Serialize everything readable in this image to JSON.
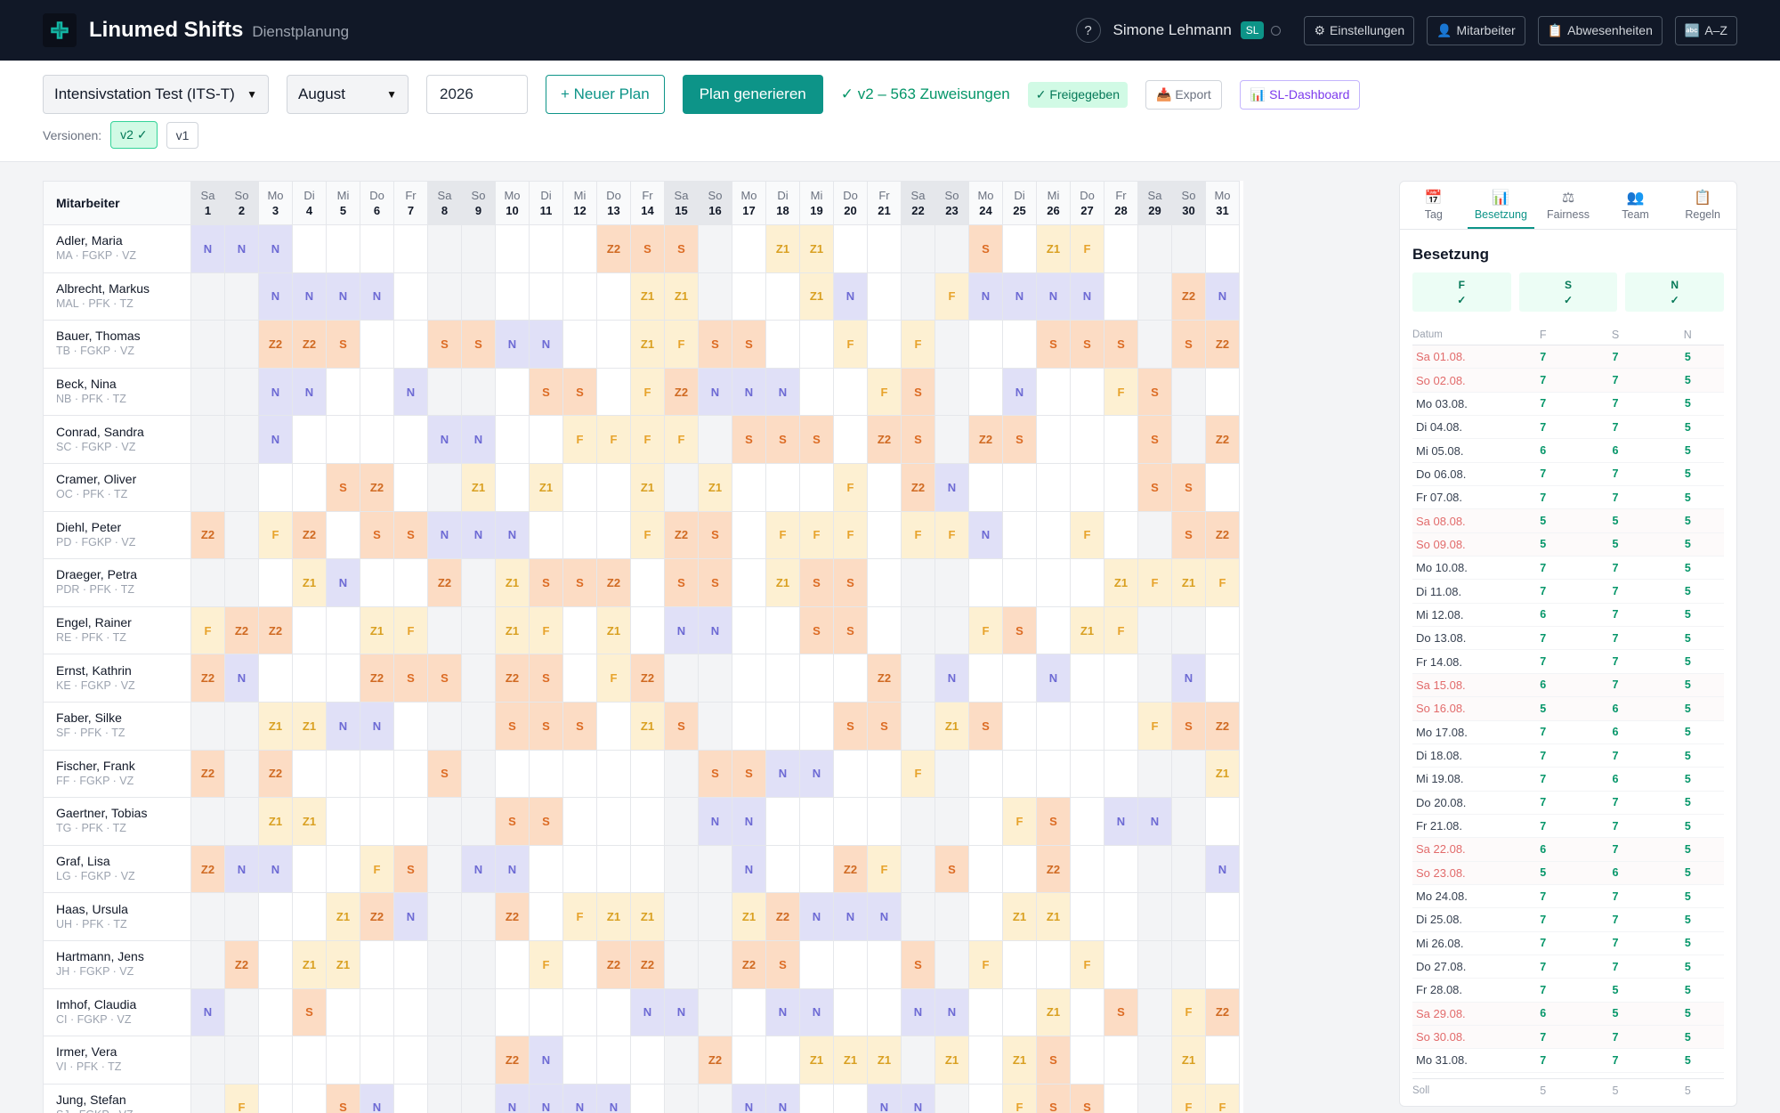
{
  "app": {
    "title": "Linumed Shifts",
    "subtitle": "Dienstplanung"
  },
  "topnav": {
    "help": "?",
    "user_name": "Simone Lehmann",
    "user_badge": "SL",
    "buttons": [
      {
        "icon": "gear-icon",
        "glyph": "⚙",
        "label": "Einstellungen"
      },
      {
        "icon": "user-icon",
        "glyph": "👤",
        "label": "Mitarbeiter"
      },
      {
        "icon": "clipboard-icon",
        "glyph": "📋",
        "label": "Abwesenheiten"
      },
      {
        "icon": "sort-az-icon",
        "glyph": "🔤",
        "label": "A–Z"
      }
    ]
  },
  "controls": {
    "station": "Intensivstation Test (ITS-T)",
    "month": "August",
    "year": "2026",
    "new_plan": "+ Neuer Plan",
    "generate": "Plan generieren",
    "status": "✓ v2 – 563 Zuweisungen",
    "released": "✓ Freigegeben",
    "export": "📥 Export",
    "sl_dashboard": "📊 SL-Dashboard",
    "versions_label": "Versionen:",
    "versions": [
      "v2 ✓",
      "v1"
    ]
  },
  "grid": {
    "employee_header": "Mitarbeiter",
    "days": [
      {
        "n": "Sa",
        "d": "1",
        "we": true
      },
      {
        "n": "So",
        "d": "2",
        "we": true
      },
      {
        "n": "Mo",
        "d": "3"
      },
      {
        "n": "Di",
        "d": "4"
      },
      {
        "n": "Mi",
        "d": "5"
      },
      {
        "n": "Do",
        "d": "6"
      },
      {
        "n": "Fr",
        "d": "7"
      },
      {
        "n": "Sa",
        "d": "8",
        "we": true
      },
      {
        "n": "So",
        "d": "9",
        "we": true
      },
      {
        "n": "Mo",
        "d": "10"
      },
      {
        "n": "Di",
        "d": "11"
      },
      {
        "n": "Mi",
        "d": "12"
      },
      {
        "n": "Do",
        "d": "13"
      },
      {
        "n": "Fr",
        "d": "14"
      },
      {
        "n": "Sa",
        "d": "15",
        "we": true
      },
      {
        "n": "So",
        "d": "16",
        "we": true
      },
      {
        "n": "Mo",
        "d": "17"
      },
      {
        "n": "Di",
        "d": "18"
      },
      {
        "n": "Mi",
        "d": "19"
      },
      {
        "n": "Do",
        "d": "20"
      },
      {
        "n": "Fr",
        "d": "21"
      },
      {
        "n": "Sa",
        "d": "22",
        "we": true
      },
      {
        "n": "So",
        "d": "23",
        "we": true
      },
      {
        "n": "Mo",
        "d": "24"
      },
      {
        "n": "Di",
        "d": "25"
      },
      {
        "n": "Mi",
        "d": "26"
      },
      {
        "n": "Do",
        "d": "27"
      },
      {
        "n": "Fr",
        "d": "28"
      },
      {
        "n": "Sa",
        "d": "29",
        "we": true
      },
      {
        "n": "So",
        "d": "30",
        "we": true
      },
      {
        "n": "Mo",
        "d": "31"
      }
    ],
    "employees": [
      {
        "name": "Adler, Maria",
        "meta": "MA · FGKP · VZ",
        "shifts": [
          "N",
          "N",
          "N",
          "",
          "",
          "",
          "",
          "",
          "",
          "",
          "",
          "",
          "Z2",
          "S",
          "S",
          "",
          "",
          "Z1",
          "Z1",
          "",
          "",
          "",
          "",
          "S",
          "",
          "Z1",
          "F",
          "",
          "",
          "",
          ""
        ]
      },
      {
        "name": "Albrecht, Markus",
        "meta": "MAL · PFK · TZ",
        "shifts": [
          "",
          "",
          "N",
          "N",
          "N",
          "N",
          "",
          "",
          "",
          "",
          "",
          "",
          "",
          "Z1",
          "Z1",
          "",
          "",
          "",
          "Z1",
          "N",
          "",
          "",
          "F",
          "N",
          "N",
          "N",
          "N",
          "",
          "",
          "Z2",
          "N"
        ]
      },
      {
        "name": "Bauer, Thomas",
        "meta": "TB · FGKP · VZ",
        "shifts": [
          "",
          "",
          "Z2",
          "Z2",
          "S",
          "",
          "",
          "S",
          "S",
          "N",
          "N",
          "",
          "",
          "Z1",
          "F",
          "S",
          "S",
          "",
          "",
          "F",
          "",
          "F",
          "",
          "",
          "",
          "S",
          "S",
          "S",
          "",
          "S",
          "Z2"
        ]
      },
      {
        "name": "Beck, Nina",
        "meta": "NB · PFK · TZ",
        "shifts": [
          "",
          "",
          "N",
          "N",
          "",
          "",
          "N",
          "",
          "",
          "",
          "S",
          "S",
          "",
          "F",
          "Z2",
          "N",
          "N",
          "N",
          "",
          "",
          "F",
          "S",
          "",
          "",
          "N",
          "",
          "",
          "F",
          "S",
          "",
          ""
        ]
      },
      {
        "name": "Conrad, Sandra",
        "meta": "SC · FGKP · VZ",
        "shifts": [
          "",
          "",
          "N",
          "",
          "",
          "",
          "",
          "N",
          "N",
          "",
          "",
          "F",
          "F",
          "F",
          "F",
          "",
          "S",
          "S",
          "S",
          "",
          "Z2",
          "S",
          "",
          "Z2",
          "S",
          "",
          "",
          "",
          "S",
          "",
          "Z2"
        ]
      },
      {
        "name": "Cramer, Oliver",
        "meta": "OC · PFK · TZ",
        "shifts": [
          "",
          "",
          "",
          "",
          "S",
          "Z2",
          "",
          "",
          "Z1",
          "",
          "Z1",
          "",
          "",
          "Z1",
          "",
          "Z1",
          "",
          "",
          "",
          "F",
          "",
          "Z2",
          "N",
          "",
          "",
          "",
          "",
          "",
          "S",
          "S",
          ""
        ]
      },
      {
        "name": "Diehl, Peter",
        "meta": "PD · FGKP · VZ",
        "shifts": [
          "Z2",
          "",
          "F",
          "Z2",
          "",
          "S",
          "S",
          "N",
          "N",
          "N",
          "",
          "",
          "",
          "F",
          "Z2",
          "S",
          "",
          "F",
          "F",
          "F",
          "",
          "F",
          "F",
          "N",
          "",
          "",
          "F",
          "",
          "",
          "S",
          "Z2"
        ]
      },
      {
        "name": "Draeger, Petra",
        "meta": "PDR · PFK · TZ",
        "shifts": [
          "",
          "",
          "",
          "Z1",
          "N",
          "",
          "",
          "Z2",
          "",
          "Z1",
          "S",
          "S",
          "Z2",
          "",
          "S",
          "S",
          "",
          "Z1",
          "S",
          "S",
          "",
          "",
          "",
          "",
          "",
          "",
          "",
          "Z1",
          "F",
          "Z1",
          "F"
        ]
      },
      {
        "name": "Engel, Rainer",
        "meta": "RE · PFK · TZ",
        "shifts": [
          "F",
          "Z2",
          "Z2",
          "",
          "",
          "Z1",
          "F",
          "",
          "",
          "Z1",
          "F",
          "",
          "Z1",
          "",
          "N",
          "N",
          "",
          "",
          "S",
          "S",
          "",
          "",
          "",
          "F",
          "S",
          "",
          "Z1",
          "F",
          "",
          "",
          ""
        ]
      },
      {
        "name": "Ernst, Kathrin",
        "meta": "KE · FGKP · VZ",
        "shifts": [
          "Z2",
          "N",
          "",
          "",
          "",
          "Z2",
          "S",
          "S",
          "",
          "Z2",
          "S",
          "",
          "F",
          "Z2",
          "",
          "",
          "",
          "",
          "",
          "",
          "Z2",
          "",
          "N",
          "",
          "",
          "N",
          "",
          "",
          "",
          "N",
          ""
        ]
      },
      {
        "name": "Faber, Silke",
        "meta": "SF · PFK · TZ",
        "shifts": [
          "",
          "",
          "Z1",
          "Z1",
          "N",
          "N",
          "",
          "",
          "",
          "S",
          "S",
          "S",
          "",
          "Z1",
          "S",
          "",
          "",
          "",
          "",
          "S",
          "S",
          "",
          "Z1",
          "S",
          "",
          "",
          "",
          "",
          "F",
          "S",
          "Z2"
        ]
      },
      {
        "name": "Fischer, Frank",
        "meta": "FF · FGKP · VZ",
        "shifts": [
          "Z2",
          "",
          "Z2",
          "",
          "",
          "",
          "",
          "S",
          "",
          "",
          "",
          "",
          "",
          "",
          "",
          "S",
          "S",
          "N",
          "N",
          "",
          "",
          "F",
          "",
          "",
          "",
          "",
          "",
          "",
          "",
          "",
          "Z1"
        ]
      },
      {
        "name": "Gaertner, Tobias",
        "meta": "TG · PFK · TZ",
        "shifts": [
          "",
          "",
          "Z1",
          "Z1",
          "",
          "",
          "",
          "",
          "",
          "S",
          "S",
          "",
          "",
          "",
          "",
          "N",
          "N",
          "",
          "",
          "",
          "",
          "",
          "",
          "",
          "F",
          "S",
          "",
          "N",
          "N",
          "",
          ""
        ]
      },
      {
        "name": "Graf, Lisa",
        "meta": "LG · FGKP · VZ",
        "shifts": [
          "Z2",
          "N",
          "N",
          "",
          "",
          "F",
          "S",
          "",
          "N",
          "N",
          "",
          "",
          "",
          "",
          "",
          "",
          "N",
          "",
          "",
          "Z2",
          "F",
          "",
          "S",
          "",
          "",
          "Z2",
          "",
          "",
          "",
          "",
          "N"
        ]
      },
      {
        "name": "Haas, Ursula",
        "meta": "UH · PFK · TZ",
        "shifts": [
          "",
          "",
          "",
          "",
          "Z1",
          "Z2",
          "N",
          "",
          "",
          "Z2",
          "",
          "F",
          "Z1",
          "Z1",
          "",
          "",
          "Z1",
          "Z2",
          "N",
          "N",
          "N",
          "",
          "",
          "",
          "Z1",
          "Z1",
          "",
          "",
          "",
          "",
          ""
        ]
      },
      {
        "name": "Hartmann, Jens",
        "meta": "JH · FGKP · VZ",
        "shifts": [
          "",
          "Z2",
          "",
          "Z1",
          "Z1",
          "",
          "",
          "",
          "",
          "",
          "F",
          "",
          "Z2",
          "Z2",
          "",
          "",
          "Z2",
          "S",
          "",
          "",
          "",
          "S",
          "",
          "F",
          "",
          "",
          "F",
          "",
          "",
          "",
          ""
        ]
      },
      {
        "name": "Imhof, Claudia",
        "meta": "CI · FGKP · VZ",
        "shifts": [
          "N",
          "",
          "",
          "S",
          "",
          "",
          "",
          "",
          "",
          "",
          "",
          "",
          "",
          "N",
          "N",
          "",
          "",
          "N",
          "N",
          "",
          "",
          "N",
          "N",
          "",
          "",
          "Z1",
          "",
          "S",
          "",
          "F",
          "Z2"
        ]
      },
      {
        "name": "Irmer, Vera",
        "meta": "VI · PFK · TZ",
        "shifts": [
          "",
          "",
          "",
          "",
          "",
          "",
          "",
          "",
          "",
          "Z2",
          "N",
          "",
          "",
          "",
          "",
          "Z2",
          "",
          "",
          "Z1",
          "Z1",
          "Z1",
          "",
          "Z1",
          "",
          "Z1",
          "S",
          "",
          "",
          "",
          "Z1",
          ""
        ]
      },
      {
        "name": "Jung, Stefan",
        "meta": "SJ · FGKP · VZ",
        "shifts": [
          "",
          "F",
          "",
          "",
          "S",
          "N",
          "",
          "",
          "",
          "N",
          "N",
          "N",
          "N",
          "",
          "",
          "",
          "N",
          "N",
          "",
          "",
          "N",
          "N",
          "",
          "",
          "F",
          "S",
          "S",
          "",
          "",
          "F",
          "F"
        ]
      }
    ]
  },
  "panel": {
    "tabs": [
      {
        "icon": "calendar-icon",
        "glyph": "📅",
        "label": "Tag"
      },
      {
        "icon": "chart-icon",
        "glyph": "📊",
        "label": "Besetzung",
        "active": true
      },
      {
        "icon": "scale-icon",
        "glyph": "⚖",
        "label": "Fairness"
      },
      {
        "icon": "team-icon",
        "glyph": "👥",
        "label": "Team"
      },
      {
        "icon": "rules-icon",
        "glyph": "📋",
        "label": "Regeln"
      }
    ],
    "title": "Besetzung",
    "summary": [
      {
        "label": "F",
        "check": "✓"
      },
      {
        "label": "S",
        "check": "✓"
      },
      {
        "label": "N",
        "check": "✓"
      }
    ],
    "headers": {
      "date": "Datum",
      "f": "F",
      "s": "S",
      "n": "N"
    },
    "rows": [
      {
        "date": "Sa 01.08.",
        "f": "7",
        "s": "7",
        "n": "5",
        "we": true
      },
      {
        "date": "So 02.08.",
        "f": "7",
        "s": "7",
        "n": "5",
        "we": true
      },
      {
        "date": "Mo 03.08.",
        "f": "7",
        "s": "7",
        "n": "5"
      },
      {
        "date": "Di 04.08.",
        "f": "7",
        "s": "7",
        "n": "5"
      },
      {
        "date": "Mi 05.08.",
        "f": "6",
        "s": "6",
        "n": "5"
      },
      {
        "date": "Do 06.08.",
        "f": "7",
        "s": "7",
        "n": "5"
      },
      {
        "date": "Fr 07.08.",
        "f": "7",
        "s": "7",
        "n": "5"
      },
      {
        "date": "Sa 08.08.",
        "f": "5",
        "s": "5",
        "n": "5",
        "we": true
      },
      {
        "date": "So 09.08.",
        "f": "5",
        "s": "5",
        "n": "5",
        "we": true
      },
      {
        "date": "Mo 10.08.",
        "f": "7",
        "s": "7",
        "n": "5"
      },
      {
        "date": "Di 11.08.",
        "f": "7",
        "s": "7",
        "n": "5"
      },
      {
        "date": "Mi 12.08.",
        "f": "6",
        "s": "7",
        "n": "5"
      },
      {
        "date": "Do 13.08.",
        "f": "7",
        "s": "7",
        "n": "5"
      },
      {
        "date": "Fr 14.08.",
        "f": "7",
        "s": "7",
        "n": "5"
      },
      {
        "date": "Sa 15.08.",
        "f": "6",
        "s": "7",
        "n": "5",
        "we": true
      },
      {
        "date": "So 16.08.",
        "f": "5",
        "s": "6",
        "n": "5",
        "we": true
      },
      {
        "date": "Mo 17.08.",
        "f": "7",
        "s": "6",
        "n": "5"
      },
      {
        "date": "Di 18.08.",
        "f": "7",
        "s": "7",
        "n": "5"
      },
      {
        "date": "Mi 19.08.",
        "f": "7",
        "s": "6",
        "n": "5"
      },
      {
        "date": "Do 20.08.",
        "f": "7",
        "s": "7",
        "n": "5"
      },
      {
        "date": "Fr 21.08.",
        "f": "7",
        "s": "7",
        "n": "5"
      },
      {
        "date": "Sa 22.08.",
        "f": "6",
        "s": "7",
        "n": "5",
        "we": true
      },
      {
        "date": "So 23.08.",
        "f": "5",
        "s": "6",
        "n": "5",
        "we": true
      },
      {
        "date": "Mo 24.08.",
        "f": "7",
        "s": "7",
        "n": "5"
      },
      {
        "date": "Di 25.08.",
        "f": "7",
        "s": "7",
        "n": "5"
      },
      {
        "date": "Mi 26.08.",
        "f": "7",
        "s": "7",
        "n": "5"
      },
      {
        "date": "Do 27.08.",
        "f": "7",
        "s": "7",
        "n": "5"
      },
      {
        "date": "Fr 28.08.",
        "f": "7",
        "s": "5",
        "n": "5"
      },
      {
        "date": "Sa 29.08.",
        "f": "6",
        "s": "5",
        "n": "5",
        "we": true
      },
      {
        "date": "So 30.08.",
        "f": "7",
        "s": "7",
        "n": "5",
        "we": true
      },
      {
        "date": "Mo 31.08.",
        "f": "7",
        "s": "7",
        "n": "5"
      }
    ],
    "footer": {
      "label": "Soll",
      "f": "5",
      "s": "5",
      "n": "5"
    }
  },
  "colors": {
    "brand": "#0d9488",
    "topbar": "#111827",
    "shift_N": "#e0e0f7",
    "shift_S": "#fcdcc4",
    "shift_F": "#fdf0d2",
    "ok_green": "#059669",
    "weekend_red": "#e26b6b"
  }
}
